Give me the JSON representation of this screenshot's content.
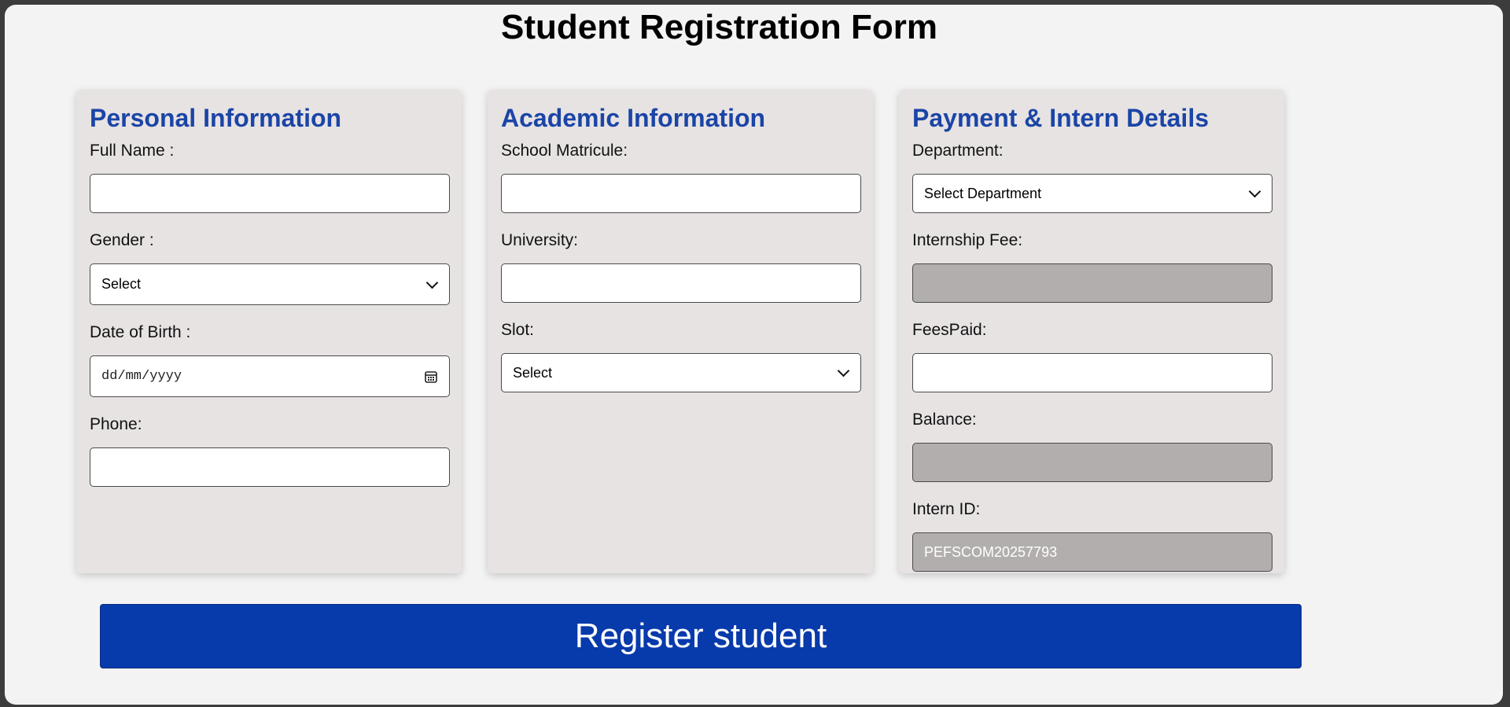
{
  "page": {
    "title": "Student Registration Form"
  },
  "personal": {
    "heading": "Personal Information",
    "full_name_label": "Full Name :",
    "full_name_value": "",
    "gender_label": "Gender :",
    "gender_selected": "Select",
    "dob_label": "Date of Birth :",
    "dob_placeholder": "dd/mm/yyyy",
    "phone_label": "Phone:",
    "phone_value": ""
  },
  "academic": {
    "heading": "Academic Information",
    "matricule_label": "School Matricule:",
    "matricule_value": "",
    "university_label": "University:",
    "university_value": "",
    "slot_label": "Slot:",
    "slot_selected": "Select"
  },
  "payment": {
    "heading": "Payment & Intern Details",
    "department_label": "Department:",
    "department_selected": "Select Department",
    "fee_label": "Internship Fee:",
    "fee_value": "",
    "fees_paid_label": "FeesPaid:",
    "fees_paid_value": "",
    "balance_label": "Balance:",
    "balance_value": "",
    "intern_id_label": "Intern ID:",
    "intern_id_value": "PEFSCOM20257793"
  },
  "actions": {
    "register_label": "Register student"
  },
  "colors": {
    "heading": "#1b45a6",
    "button": "#073aab",
    "card": "#e7e3e3",
    "readonly_field": "#b3aeae"
  }
}
